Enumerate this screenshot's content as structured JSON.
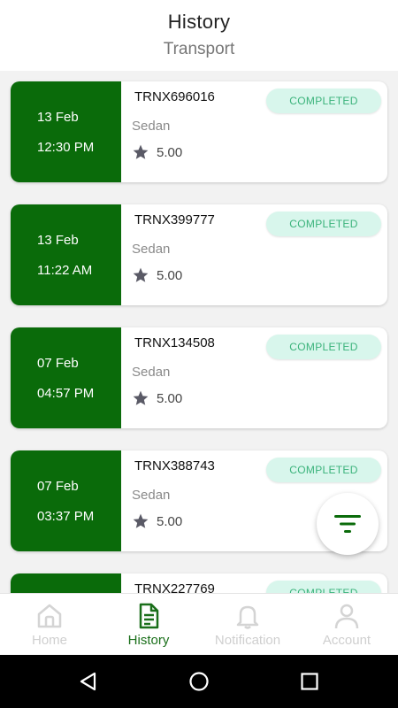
{
  "header": {
    "title": "History",
    "subtitle": "Transport"
  },
  "transactions": [
    {
      "date": "13 Feb",
      "time": "12:30 PM",
      "id": "TRNX696016",
      "vehicle": "Sedan",
      "rating": "5.00",
      "status": "COMPLETED"
    },
    {
      "date": "13 Feb",
      "time": "11:22 AM",
      "id": "TRNX399777",
      "vehicle": "Sedan",
      "rating": "5.00",
      "status": "COMPLETED"
    },
    {
      "date": "07 Feb",
      "time": "04:57 PM",
      "id": "TRNX134508",
      "vehicle": "Sedan",
      "rating": "5.00",
      "status": "COMPLETED"
    },
    {
      "date": "07 Feb",
      "time": "03:37 PM",
      "id": "TRNX388743",
      "vehicle": "Sedan",
      "rating": "5.00",
      "status": "COMPLETED"
    },
    {
      "date": "",
      "time": "",
      "id": "TRNX227769",
      "vehicle": "",
      "rating": "",
      "status": "COMPLETED"
    }
  ],
  "tabs": [
    {
      "label": "Home",
      "icon": "home-icon",
      "active": false
    },
    {
      "label": "History",
      "icon": "document-icon",
      "active": true
    },
    {
      "label": "Notification",
      "icon": "bell-icon",
      "active": false
    },
    {
      "label": "Account",
      "icon": "user-icon",
      "active": false
    }
  ],
  "colors": {
    "accent": "#0a6b0a",
    "badge_bg": "#d8f6ec",
    "badge_text": "#3bb37b",
    "tab_active": "#1a6f1a",
    "tab_inactive": "#cfcfcf"
  },
  "fab": {
    "icon": "filter-icon"
  },
  "system_nav": {
    "back": "back-icon",
    "home": "home-circle-icon",
    "recents": "recents-icon"
  }
}
